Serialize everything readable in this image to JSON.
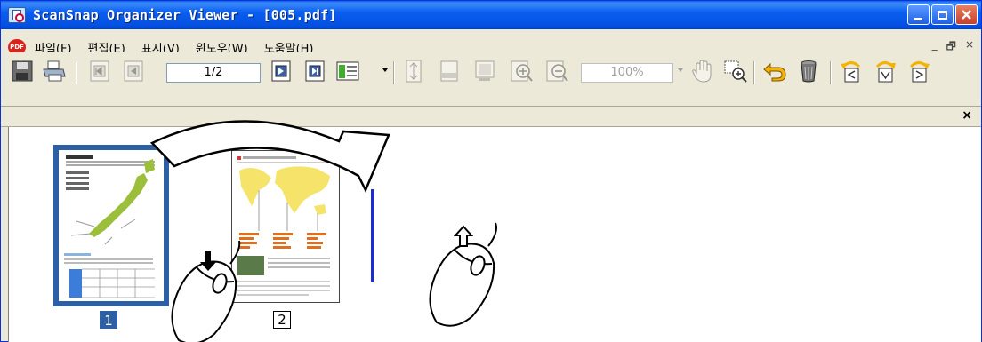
{
  "window": {
    "title": "ScanSnap Organizer Viewer - [005.pdf]"
  },
  "menu": {
    "items": [
      "파일(F)",
      "편집(E)",
      "표시(V)",
      "윈도우(W)",
      "도움말(H)"
    ],
    "pdf_badge": "PDF"
  },
  "mdi_controls": [
    "_",
    "🗗",
    "×"
  ],
  "toolbar": {
    "page_field": "1/2",
    "zoom_field": "100%"
  },
  "strip": {
    "close_label": "×"
  },
  "thumbnails": [
    {
      "label": "1",
      "selected": true
    },
    {
      "label": "2",
      "selected": false
    }
  ],
  "colors": {
    "titlebar": "#0a5ef0",
    "selection": "#2c5fa3",
    "drop_indicator": "#1a2bd8"
  },
  "icons": [
    "save-icon",
    "print-icon",
    "first-page-icon",
    "prev-page-icon",
    "next-page-icon",
    "last-page-icon",
    "view-mode-icon",
    "fit-height-icon",
    "fit-width-icon",
    "fit-page-icon",
    "zoom-in-icon",
    "zoom-out-icon",
    "hand-tool-icon",
    "zoom-area-icon",
    "undo-icon",
    "delete-icon",
    "rotate-left-icon",
    "rotate-180-icon",
    "rotate-right-icon"
  ]
}
